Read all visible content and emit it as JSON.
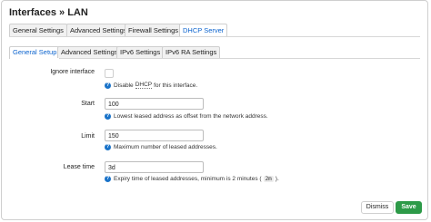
{
  "dialog": {
    "title": "Interfaces » LAN"
  },
  "tabs_top": [
    {
      "label": "General Settings",
      "active": false
    },
    {
      "label": "Advanced Settings",
      "active": false
    },
    {
      "label": "Firewall Settings",
      "active": false
    },
    {
      "label": "DHCP Server",
      "active": true
    }
  ],
  "tabs_sub": [
    {
      "label": "General Setup",
      "active": true
    },
    {
      "label": "Advanced Settings",
      "active": false
    },
    {
      "label": "IPv6 Settings",
      "active": false
    },
    {
      "label": "IPv6 RA Settings",
      "active": false
    }
  ],
  "fields": {
    "ignore": {
      "label": "Ignore interface",
      "checked": false,
      "help_pre": "Disable",
      "help_link": "DHCP",
      "help_post": "for this interface."
    },
    "start": {
      "label": "Start",
      "value": "100",
      "help": "Lowest leased address as offset from the network address."
    },
    "limit": {
      "label": "Limit",
      "value": "150",
      "help": "Maximum number of leased addresses."
    },
    "leasetime": {
      "label": "Lease time",
      "value": "3d",
      "help_pre": "Expiry time of leased addresses, minimum is 2 minutes (",
      "help_code": "2m",
      "help_post": ")."
    }
  },
  "buttons": {
    "dismiss": "Dismiss",
    "save": "Save"
  },
  "colors": {
    "active_tab": "#0b63ce",
    "help_icon": "#1a73c9",
    "save_button": "#2d9a48"
  }
}
